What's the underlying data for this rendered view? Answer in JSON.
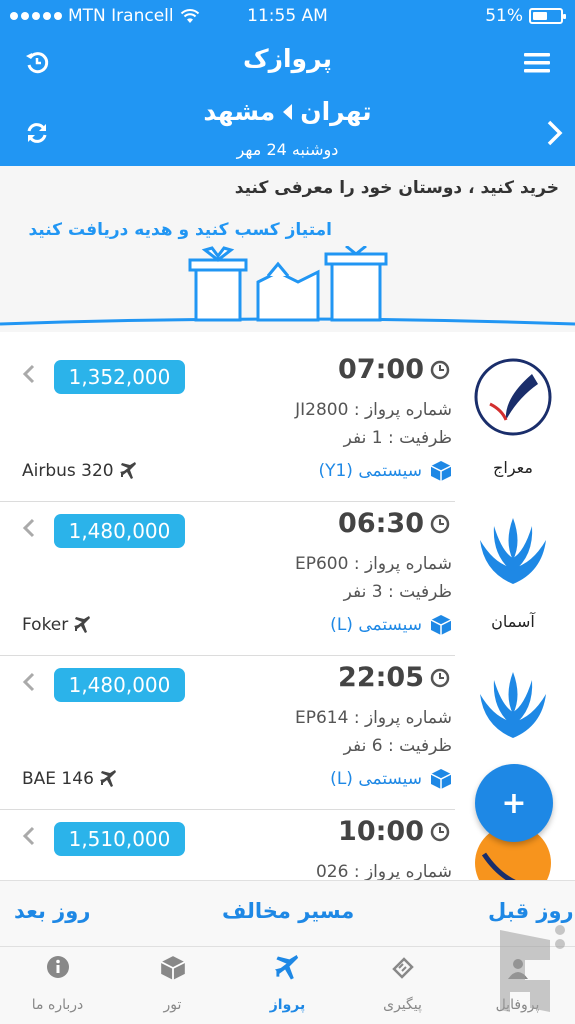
{
  "status_bar": {
    "carrier": "MTN Irancell",
    "time": "11:55 AM",
    "battery": "51%"
  },
  "header": {
    "title": "پروازک",
    "origin": "تهران",
    "destination": "مشهد",
    "date": "دوشنبه 24 مهر"
  },
  "banner": {
    "line1": "خرید کنید ، دوستان خود را معرفی کنید",
    "line2": "امتیاز کسب کنید و هدیه دریافت کنید"
  },
  "flights": [
    {
      "price": "1,352,000",
      "time": "07:00",
      "flight_no": "شماره پرواز : JI2800",
      "capacity": "ظرفیت : 1 نفر",
      "class": "سیستمی (Y1)",
      "aircraft": "Airbus 320",
      "airline": "معراج"
    },
    {
      "price": "1,480,000",
      "time": "06:30",
      "flight_no": "شماره پرواز : EP600",
      "capacity": "ظرفیت : 3 نفر",
      "class": "سیستمی (L)",
      "aircraft": "Foker",
      "airline": "آسمان"
    },
    {
      "price": "1,480,000",
      "time": "22:05",
      "flight_no": "شماره پرواز : EP614",
      "capacity": "ظرفیت : 6 نفر",
      "class": "سیستمی (L)",
      "aircraft": "BAE 146",
      "airline": ""
    },
    {
      "price": "1,510,000",
      "time": "10:00",
      "flight_no": "شماره پرواز : 026",
      "capacity": "",
      "class": "",
      "aircraft": "",
      "airline": ""
    }
  ],
  "day_nav": {
    "next": "روز بعد",
    "reverse": "مسیر مخالف",
    "prev": "روز قبل"
  },
  "tabs": [
    {
      "label": "درباره ما",
      "icon": "info-icon"
    },
    {
      "label": "تور",
      "icon": "box-icon"
    },
    {
      "label": "پرواز",
      "icon": "plane-icon",
      "active": true
    },
    {
      "label": "پیگیری",
      "icon": "ticket-icon"
    },
    {
      "label": "پروفایل",
      "icon": "user-icon"
    }
  ],
  "fab": "+",
  "colors": {
    "primary": "#2196f3",
    "price_badge": "#2bb3ea",
    "accent_text": "#1e88e5"
  }
}
